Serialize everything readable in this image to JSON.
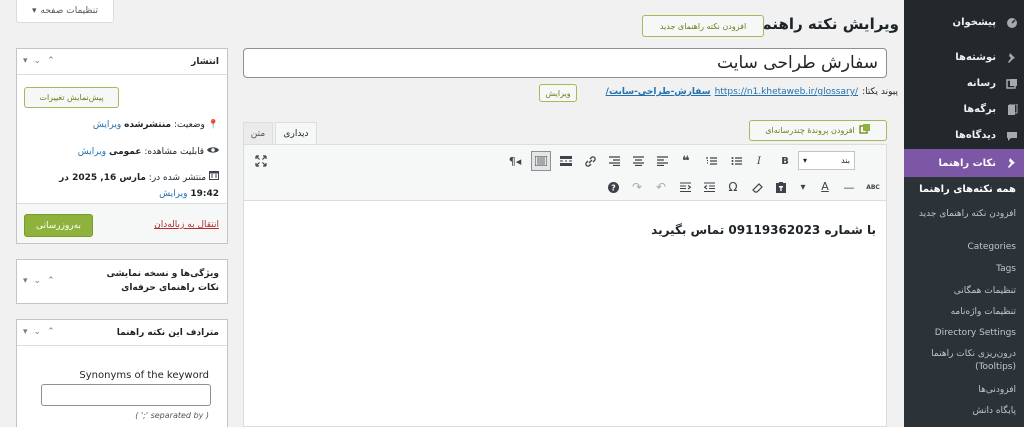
{
  "screen_options": "تنظیمات صفحه",
  "header": {
    "title": "ویرایش نکته راهنما",
    "add_new": "افزودن نکته راهنمای جدید"
  },
  "post": {
    "title": "سفارش طراحی سایت",
    "permalink_label": "پیوند یکتا:",
    "permalink_base": "https://n1.khetaweb.ir/glossary/",
    "permalink_slug": "سفارش-طراحی-سایت/",
    "edit_slug": "ویرایش"
  },
  "editor": {
    "add_media": "افزودن پروندهٔ چندرسانه‌ای",
    "tab_visual": "دیداری",
    "tab_text": "متن",
    "format_select": "بند",
    "content": "با شماره 09119362023 تماس بگیرید"
  },
  "publish": {
    "title": "انتشار",
    "preview": "پیش‌نمایش تغییرات",
    "status_label": "وضعیت:",
    "status_value": "منتشرشده",
    "status_edit": "ویرایش",
    "visibility_label": "قابلیت مشاهده:",
    "visibility_value": "عمومی",
    "visibility_edit": "ویرایش",
    "published_label": "منتشر شده در:",
    "published_date": "مارس 16, 2025 در",
    "published_time": "19:42",
    "published_edit": "ویرایش",
    "trash": "انتقال به زباله‌دان",
    "update": "به‌روزرسانی"
  },
  "features_box": {
    "title": "ویژگی‌ها و نسخه نمایشی نکات راهنمای حرفه‌ای"
  },
  "synonyms_box": {
    "title": "مترادف این نکته راهنما",
    "field_label": "Synonyms of the keyword",
    "hint": "( ';' separated by )"
  },
  "sidebar": {
    "items": [
      {
        "label": "پیشخوان",
        "icon": "dashboard-icon"
      },
      {
        "label": "نوشته‌ها",
        "icon": "pin-icon"
      },
      {
        "label": "رسانه",
        "icon": "media-icon"
      },
      {
        "label": "برگه‌ها",
        "icon": "page-icon"
      },
      {
        "label": "دیدگاه‌ها",
        "icon": "comment-icon"
      },
      {
        "label": "نکات راهنما",
        "icon": "pin-icon"
      }
    ],
    "submenu": [
      "همه نکته‌های راهنما",
      "افزودن نکته راهنمای جدید",
      "Categories",
      "Tags",
      "تنظیمات همگانی",
      "تنظیمات واژه‌نامه",
      "Directory Settings",
      "درون‌ریزی نکات راهنما (Tooltips)",
      "افزودنی‌ها",
      "پایگاه دانش"
    ]
  },
  "colors": {
    "sidebar_bg": "#23282d",
    "active_menu": "#7b57a6",
    "primary_button": "#8fb23d",
    "link": "#2271b1"
  }
}
